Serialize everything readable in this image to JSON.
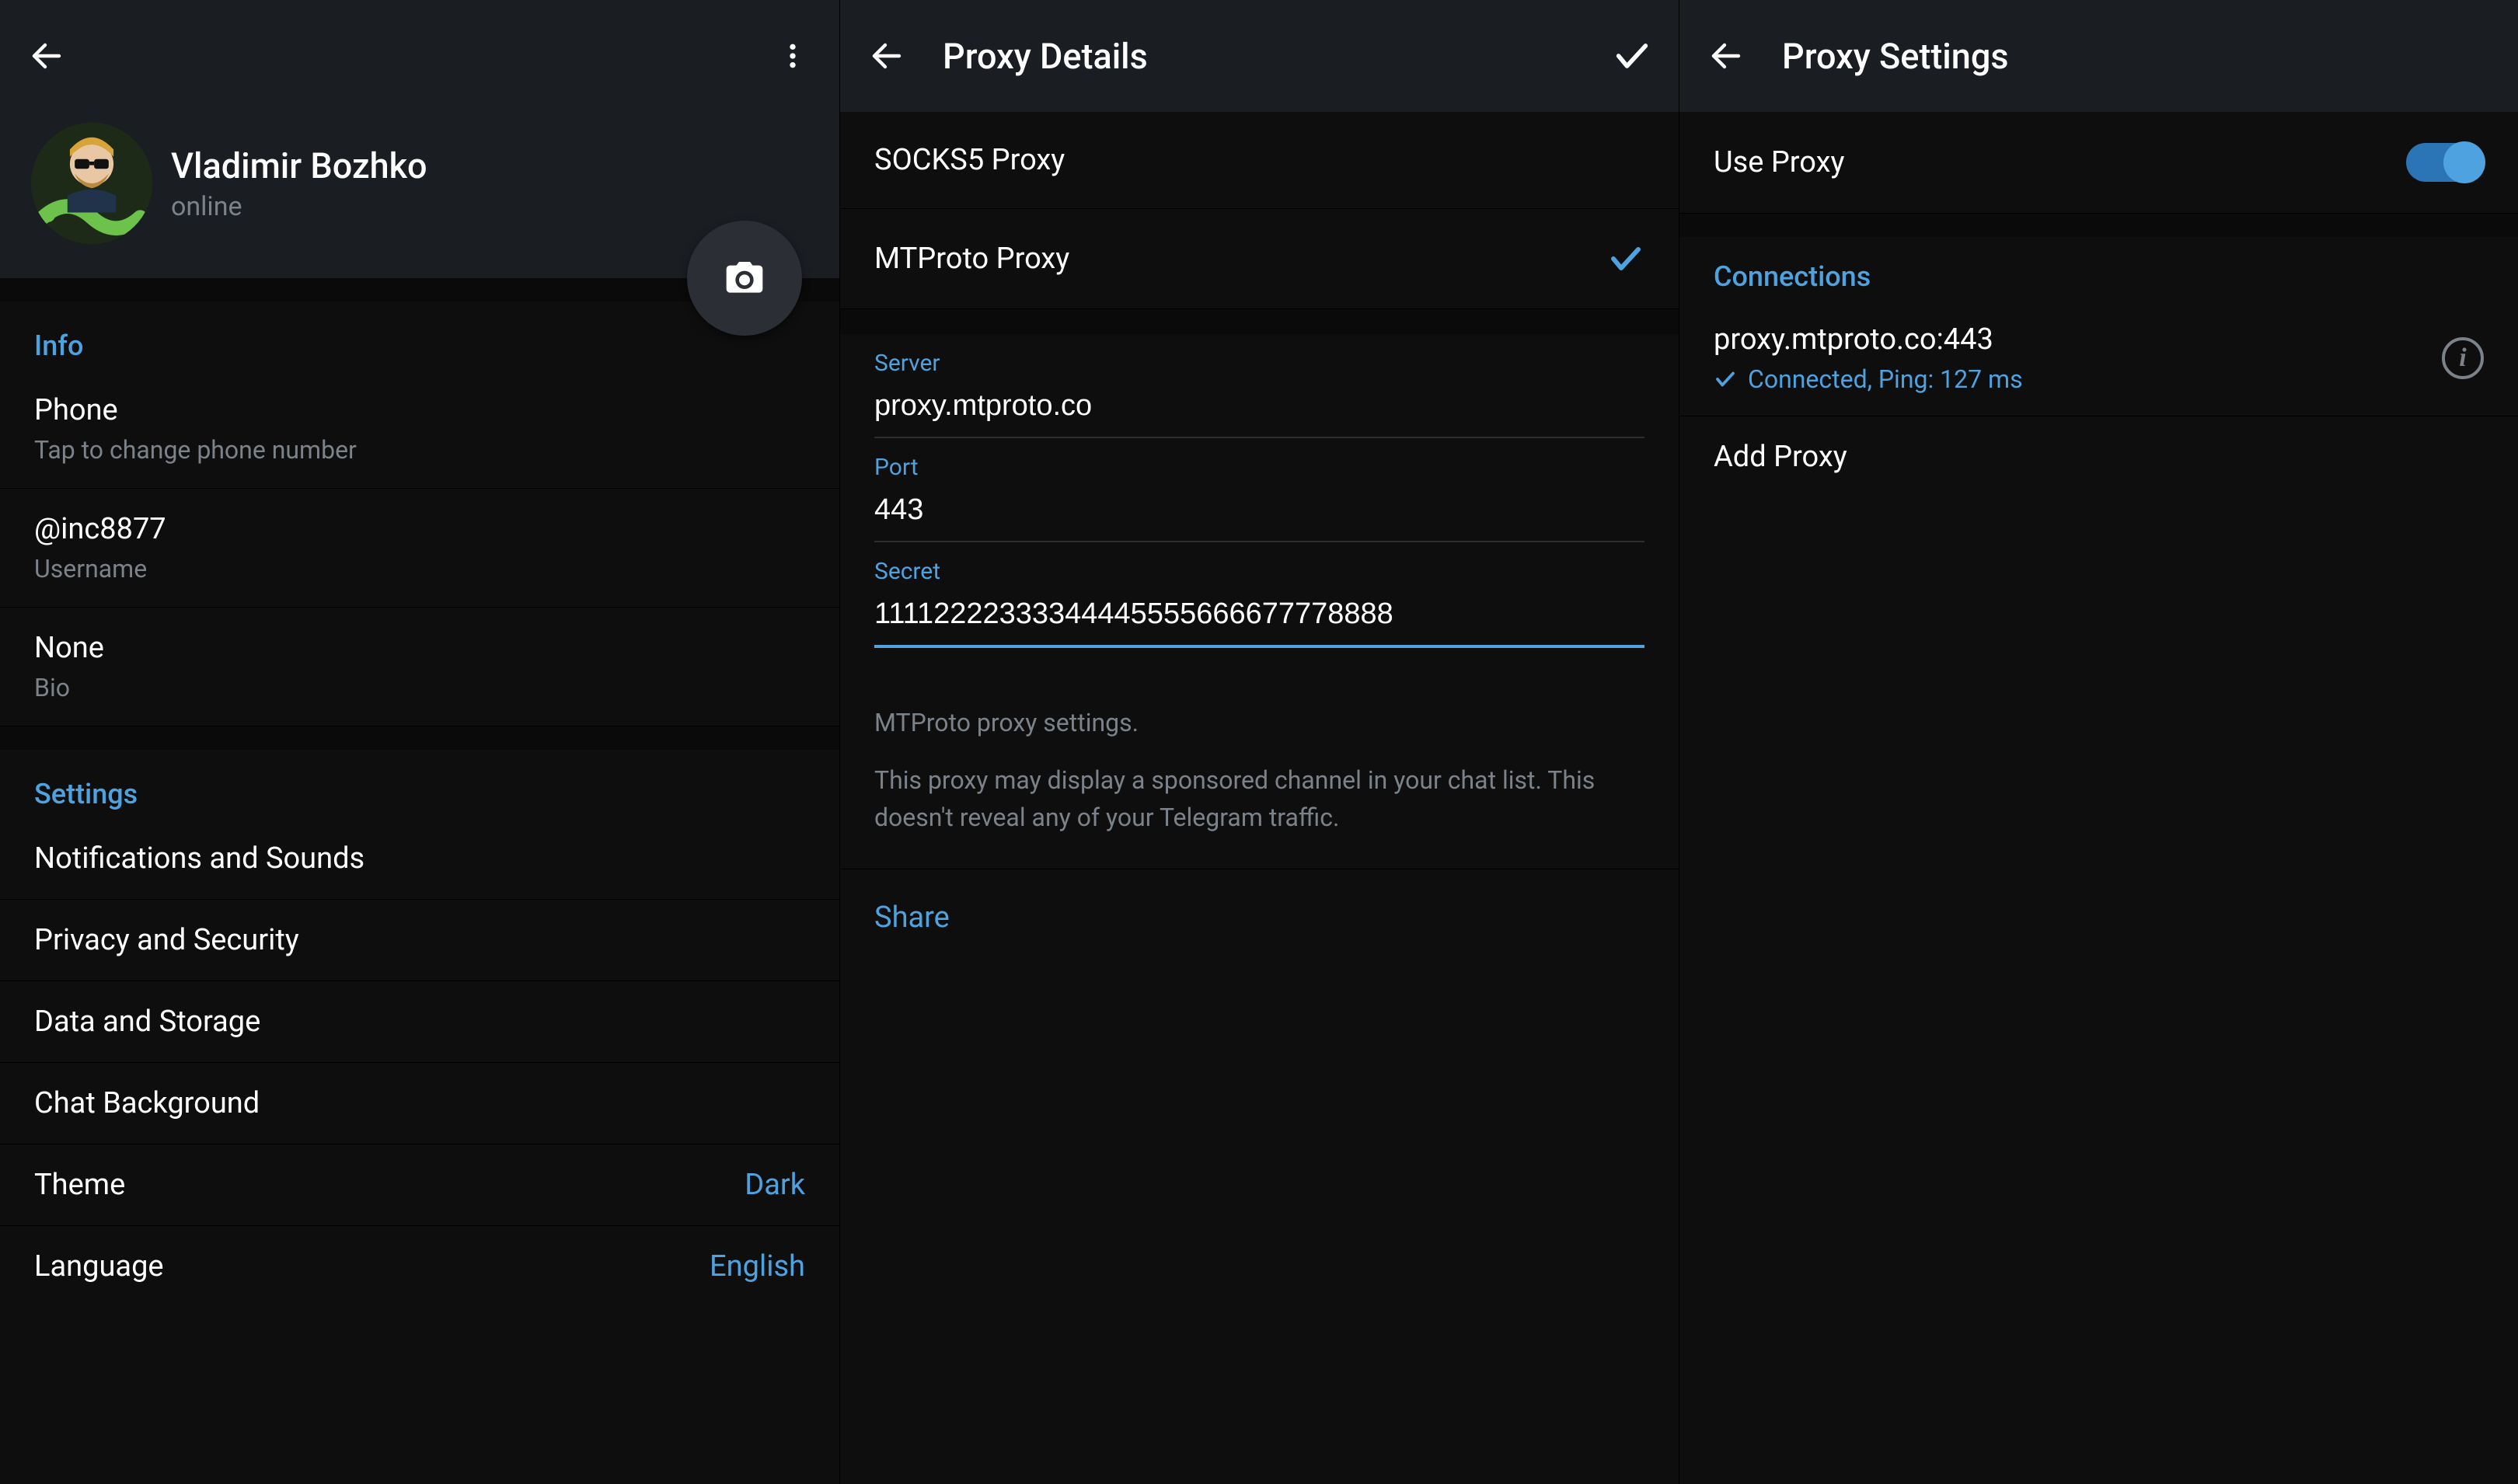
{
  "panel1": {
    "profile": {
      "name": "Vladimir Bozhko",
      "status": "online"
    },
    "info_header": "Info",
    "info": {
      "phone": {
        "primary": "Phone",
        "secondary": "Tap to change phone number"
      },
      "username": {
        "primary": "@inc8877",
        "secondary": "Username"
      },
      "bio": {
        "primary": "None",
        "secondary": "Bio"
      }
    },
    "settings_header": "Settings",
    "settings": {
      "notifications": "Notifications and Sounds",
      "privacy": "Privacy and Security",
      "data": "Data and Storage",
      "chatbg": "Chat Background",
      "theme_label": "Theme",
      "theme_value": "Dark",
      "language_label": "Language",
      "language_value": "English"
    }
  },
  "panel2": {
    "title": "Proxy Details",
    "types": {
      "socks5": "SOCKS5 Proxy",
      "mtproto": "MTProto Proxy"
    },
    "fields": {
      "server_label": "Server",
      "server_value": "proxy.mtproto.co",
      "port_label": "Port",
      "port_value": "443",
      "secret_label": "Secret",
      "secret_value": "11112222333344445555666677778888"
    },
    "help1": "MTProto proxy settings.",
    "help2": "This proxy may display a sponsored channel in your chat list. This doesn't reveal any of your Telegram traffic.",
    "share": "Share"
  },
  "panel3": {
    "title": "Proxy Settings",
    "use_proxy": "Use Proxy",
    "connections_header": "Connections",
    "connection": {
      "host": "proxy.mtproto.co:443",
      "status": "Connected, Ping: 127 ms"
    },
    "add_proxy": "Add Proxy"
  }
}
